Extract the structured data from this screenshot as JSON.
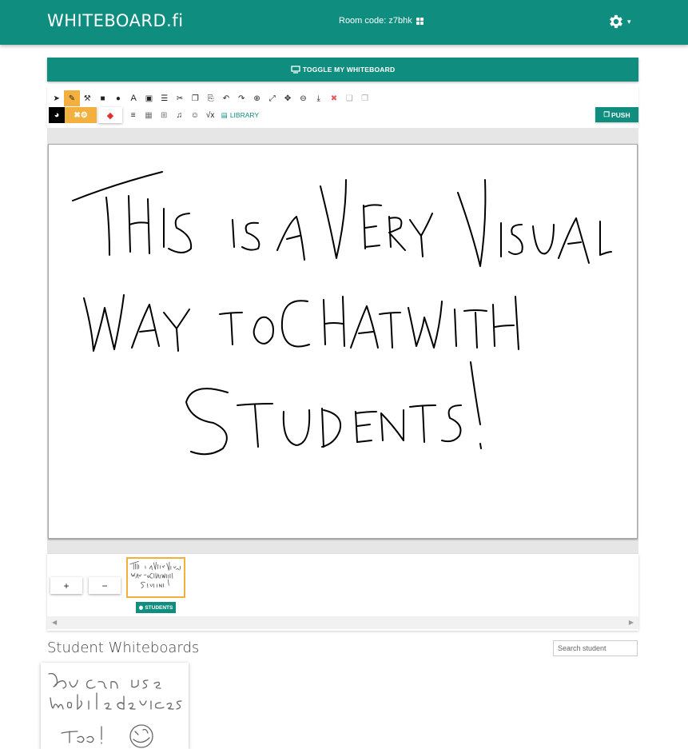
{
  "header": {
    "brand": "WHITEBOARD.fi",
    "room_code_label": "Room code: z7bhk",
    "settings_caret": "▾"
  },
  "toggle_button": {
    "label": "TOGGLE MY WHITEBOARD"
  },
  "toolbar": {
    "library_label": "LIBRARY",
    "push_label": "PUSH",
    "row1_icons": [
      "pointer-icon",
      "pen-icon",
      "tools-icon",
      "rectangle-icon",
      "circle-icon",
      "text-icon",
      "image-icon",
      "file-icon",
      "cut-icon",
      "copy-icon",
      "paste-icon",
      "undo-icon",
      "redo-icon",
      "zoom-in-icon",
      "fit-icon",
      "move-icon",
      "zoom-out-icon",
      "download-icon",
      "delete-icon",
      "send-back-icon",
      "bring-front-icon"
    ],
    "row2_icons": [
      "color-picker-icon",
      "shape-settings-icon",
      "eraser-icon",
      "layers-icon",
      "grid-icon",
      "grid-large-icon",
      "music-icon",
      "emoji-icon",
      "math-icon",
      "library-icon"
    ]
  },
  "whiteboard": {
    "handwriting_lines": [
      "This is a Very Visual",
      "Way to Chat with",
      "Students !"
    ]
  },
  "pages": {
    "add_label": "+",
    "remove_label": "−",
    "students_label": "STUDENTS",
    "thumbnail_text": [
      "This is a Very Visual",
      "Way to Chat with",
      "Students !"
    ]
  },
  "student_section": {
    "title": "Student Whiteboards",
    "search_placeholder": "Search student",
    "card_text": [
      "You can use",
      "mobile devices",
      "too!"
    ]
  },
  "colors": {
    "brand": "#0f8e80",
    "accent": "#f3b03f"
  }
}
